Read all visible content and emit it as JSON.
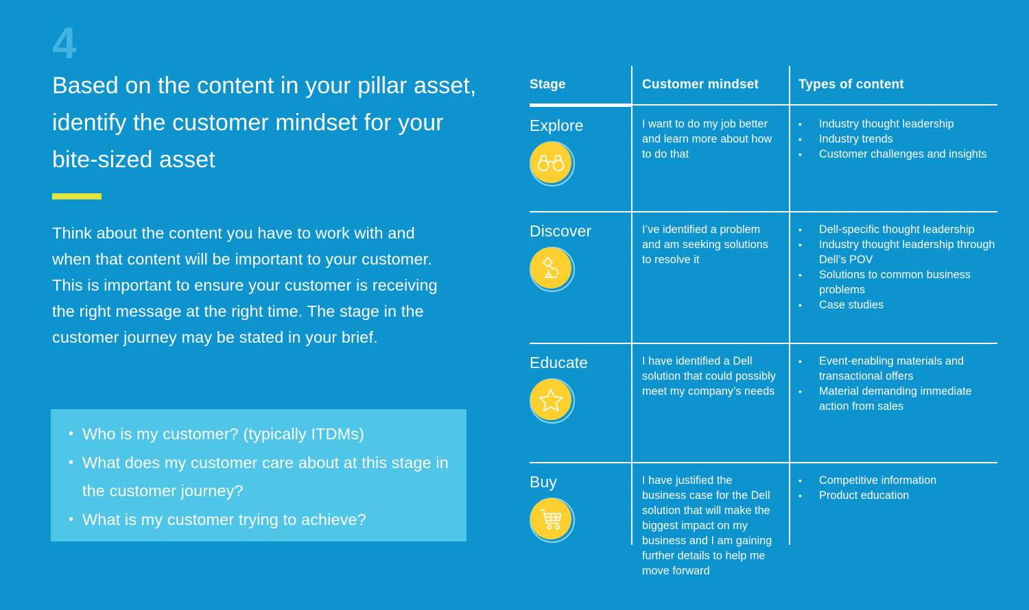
{
  "slide": {
    "step_number": "4",
    "headline": "Based on the content in your pillar asset, identify the customer mindset for your bite-sized asset",
    "body_copy": "Think about the content you have to work with and when that content will be important to your customer. This is important to ensure your customer is receiving the right message at the right time. The stage in the customer journey may be stated in your brief.",
    "callout_bullets": [
      "Who is my customer? (typically ITDMs)",
      "What does my customer care about at this stage in the customer journey?",
      "What is my customer trying to achieve?"
    ]
  },
  "colors": {
    "background": "#0d94cf",
    "step_number": "#3fb4e3",
    "accent_bar": "#e3e53f",
    "callout_bg": "#4fc6e8",
    "icon_yellow": "#fdd02f",
    "icon_ring": "#8fd6ef",
    "text": "#ffffff"
  },
  "table": {
    "headers": {
      "stage": "Stage",
      "mindset": "Customer mindset",
      "content": "Types of content"
    },
    "rows": [
      {
        "stage": "Explore",
        "icon": "binoculars-icon",
        "mindset": "I want to do my job better and learn more about how to do that",
        "content": [
          "Industry thought leadership",
          "Industry trends",
          "Customer challenges and insights"
        ]
      },
      {
        "stage": "Discover",
        "icon": "microscope-icon",
        "mindset": "I’ve identified a problem and am seeking solutions to resolve it",
        "content": [
          "Dell-specific thought leadership",
          "Industry thought leadership through Dell’s POV",
          "Solutions to common business problems",
          "Case studies"
        ]
      },
      {
        "stage": "Educate",
        "icon": "star-icon",
        "mindset": "I have identified a Dell solution that could possibly meet my company’s needs",
        "content": [
          "Event-enabling materials and transactional offers",
          "Material demanding immediate action from sales"
        ]
      },
      {
        "stage": "Buy",
        "icon": "shopping-cart-icon",
        "mindset": "I have justified the business case for the Dell solution that will make the biggest impact on my business and I am gaining further details to help me move forward",
        "content": [
          "Competitive information",
          "Product education"
        ]
      }
    ]
  }
}
